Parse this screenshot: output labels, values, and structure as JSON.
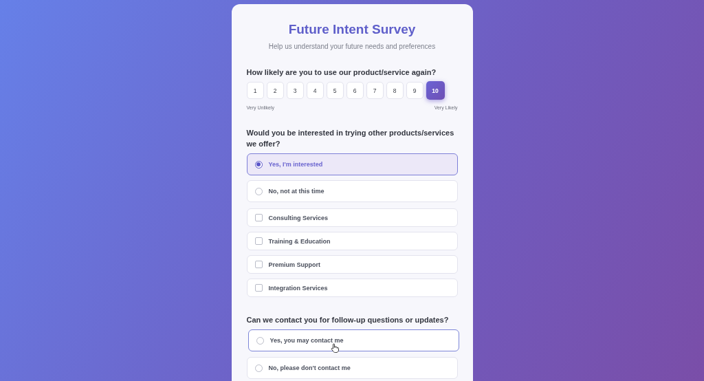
{
  "title": "Future Intent Survey",
  "subtitle": "Help us understand your future needs and preferences",
  "questions": [
    {
      "kind": "scale",
      "prompt": "How likely are you to use our product/service again?",
      "low_label": "Very Unlikely",
      "high_label": "Very Likely",
      "options": [
        {
          "label": "1",
          "selected": false
        },
        {
          "label": "2",
          "selected": false
        },
        {
          "label": "3",
          "selected": false
        },
        {
          "label": "4",
          "selected": false
        },
        {
          "label": "5",
          "selected": false
        },
        {
          "label": "6",
          "selected": false
        },
        {
          "label": "7",
          "selected": false
        },
        {
          "label": "8",
          "selected": false
        },
        {
          "label": "9",
          "selected": false
        },
        {
          "label": "10",
          "selected": true
        }
      ]
    },
    {
      "kind": "choice",
      "prompt": "Would you be interested in trying other products/services we offer?",
      "options": [
        {
          "kind": "radio",
          "label": "Yes, I'm interested",
          "selected": true,
          "hovered": false
        },
        {
          "kind": "radio",
          "label": "No, not at this time",
          "selected": false,
          "hovered": false
        },
        {
          "kind": "checkbox",
          "label": "Consulting Services",
          "checked": false
        },
        {
          "kind": "checkbox",
          "label": "Training & Education",
          "checked": false
        },
        {
          "kind": "checkbox",
          "label": "Premium Support",
          "checked": false
        },
        {
          "kind": "checkbox",
          "label": "Integration Services",
          "checked": false
        }
      ]
    },
    {
      "kind": "choice",
      "prompt": "Can we contact you for follow-up questions or updates?",
      "options": [
        {
          "kind": "radio",
          "label": "Yes, you may contact me",
          "selected": false,
          "hovered": true
        },
        {
          "kind": "radio",
          "label": "No, please don't contact me",
          "selected": false,
          "hovered": false
        }
      ]
    }
  ]
}
